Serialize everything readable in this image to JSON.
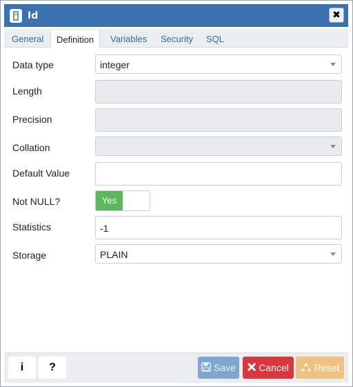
{
  "dialog": {
    "title": "Id",
    "close_glyph": "✖"
  },
  "tabs": [
    {
      "label": "General"
    },
    {
      "label": "Definition"
    },
    {
      "label": "Variables"
    },
    {
      "label": "Security"
    },
    {
      "label": "SQL"
    }
  ],
  "active_tab": "Definition",
  "form": {
    "data_type": {
      "label": "Data type",
      "value": "integer"
    },
    "length": {
      "label": "Length",
      "value": ""
    },
    "precision": {
      "label": "Precision",
      "value": ""
    },
    "collation": {
      "label": "Collation",
      "value": ""
    },
    "default_value": {
      "label": "Default Value",
      "value": ""
    },
    "not_null": {
      "label": "Not NULL?",
      "value": "Yes"
    },
    "statistics": {
      "label": "Statistics",
      "value": "-1"
    },
    "storage": {
      "label": "Storage",
      "value": "PLAIN"
    }
  },
  "footer": {
    "info_label": "i",
    "help_label": "?",
    "save_label": "Save",
    "cancel_label": "Cancel",
    "reset_label": "Reset"
  },
  "colors": {
    "titlebar": "#3a71b0",
    "toggle_on": "#5cb85c",
    "save": "#7fa6cf",
    "cancel": "#d9363e",
    "reset": "#f0c27f"
  }
}
